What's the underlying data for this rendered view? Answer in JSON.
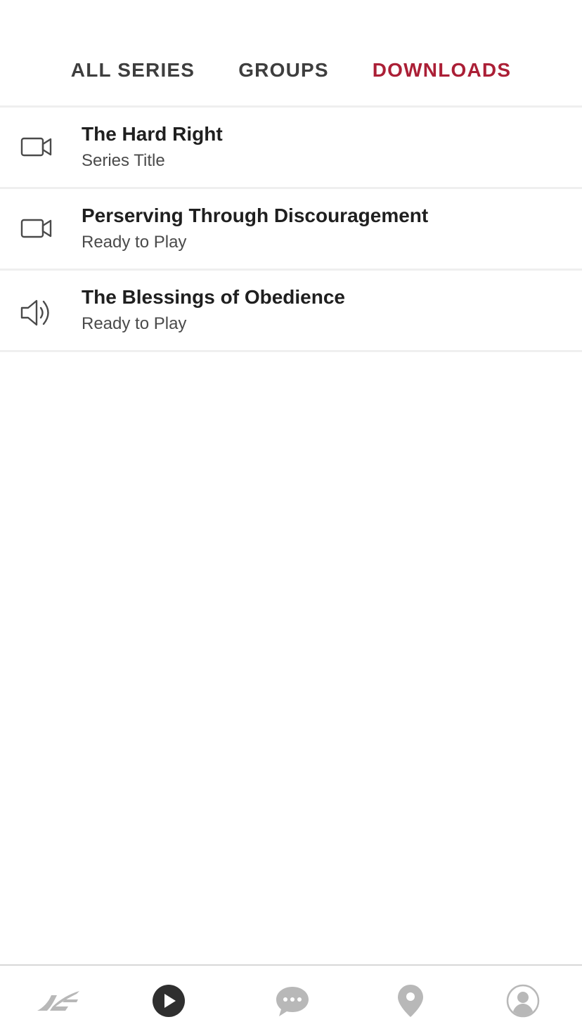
{
  "tabs": {
    "all_series": "ALL SERIES",
    "groups": "GROUPS",
    "downloads": "DOWNLOADS",
    "active": "downloads",
    "active_color": "#ab1f36"
  },
  "downloads": {
    "items": [
      {
        "title": "The Hard Right",
        "subtitle": "Series Title",
        "icon": "video-camera-icon"
      },
      {
        "title": "Perserving Through Discouragement",
        "subtitle": "Ready to Play",
        "icon": "video-camera-icon"
      },
      {
        "title": "The Blessings of Obedience",
        "subtitle": "Ready to Play",
        "icon": "speaker-icon"
      }
    ]
  },
  "bottom_nav": {
    "items": [
      {
        "icon": "church-logo-icon",
        "active": false
      },
      {
        "icon": "play-circle-icon",
        "active": true
      },
      {
        "icon": "chat-bubble-icon",
        "active": false
      },
      {
        "icon": "location-pin-icon",
        "active": false
      },
      {
        "icon": "profile-icon",
        "active": false
      }
    ]
  }
}
